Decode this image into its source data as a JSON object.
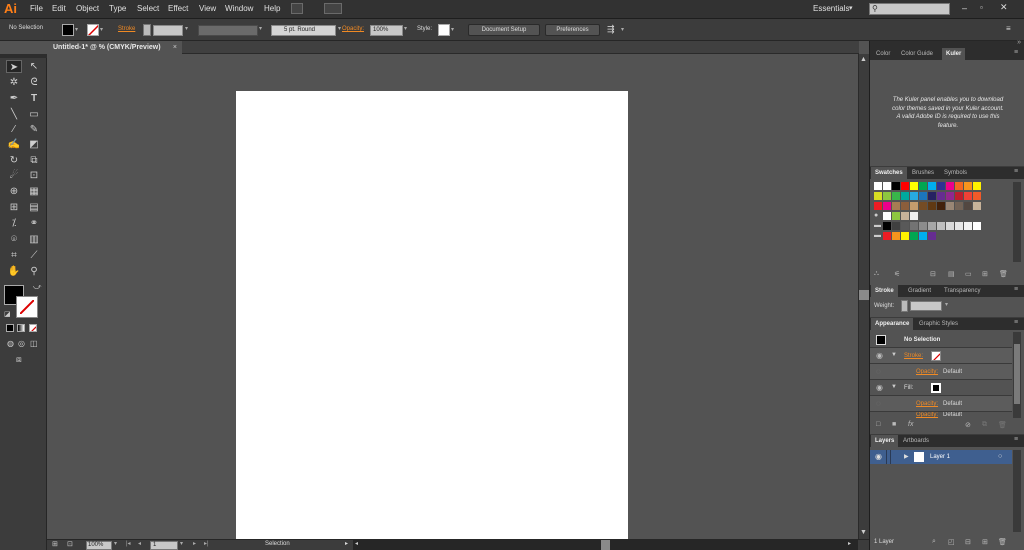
{
  "app": {
    "logo": "Ai"
  },
  "menu": [
    "File",
    "Edit",
    "Object",
    "Type",
    "Select",
    "Effect",
    "View",
    "Window",
    "Help"
  ],
  "workspace": "Essentials",
  "control": {
    "selection": "No Selection",
    "stroke_label": "Stroke",
    "brush": "5 pt. Round",
    "opacity_label": "Opacity:",
    "opacity_value": "100%",
    "style_label": "Style:",
    "doc_setup": "Document Setup",
    "preferences": "Preferences"
  },
  "document_tab": {
    "title": "Untitled-1* @ % (CMYK/Preview)",
    "close": "×"
  },
  "status": {
    "zoom": "100%",
    "artboard": "1",
    "tool": "Selection"
  },
  "panels": {
    "color_tabs": [
      "Color",
      "Color Guide",
      "Kuler"
    ],
    "kuler_message": "The Kuler panel enables you to download color themes saved in your Kuler account. A valid Adobe ID is required to use this feature.",
    "swatch_tabs": [
      "Swatches",
      "Brushes",
      "Symbols"
    ],
    "stroke_tabs": [
      "Stroke",
      "Gradient",
      "Transparency"
    ],
    "weight_label": "Weight:",
    "appearance_tabs": [
      "Appearance",
      "Graphic Styles"
    ],
    "appearance": {
      "header": "No Selection",
      "stroke_label": "Stroke:",
      "opacity_label": "Opacity:",
      "opacity_value": "Default",
      "fill_label": "Fill:",
      "opacity2_label": "Opacity:",
      "opacity2_value": "Default",
      "opacity3_label": "Opacity:",
      "opacity3_value": "Default"
    },
    "layers_tabs": [
      "Layers",
      "Artboards"
    ],
    "layer_name": "Layer 1",
    "layer_count": "1 Layer"
  },
  "colors": {
    "accent": "#ff7f18",
    "ui_dark": "#323232",
    "ui_mid": "#535353",
    "artboard": "#ffffff"
  }
}
